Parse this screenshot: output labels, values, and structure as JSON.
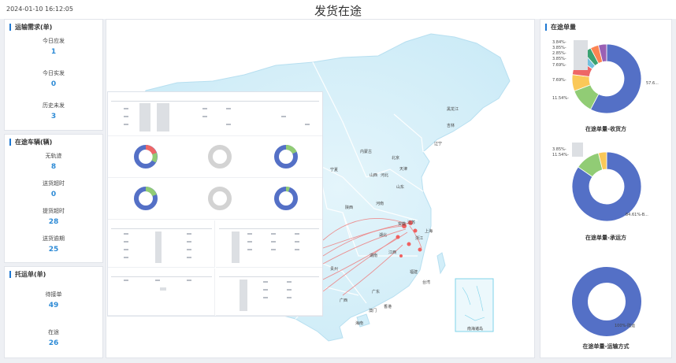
{
  "header": {
    "datetime": "2024-01-10 16:12:05",
    "title": "发货在途"
  },
  "transport_demand": {
    "title": "运输需求(单)",
    "stats": [
      {
        "label": "今日应发",
        "value": "1"
      },
      {
        "label": "今日实发",
        "value": "0"
      },
      {
        "label": "历史未发",
        "value": "3"
      }
    ]
  },
  "vehicles": {
    "title": "在途车辆(辆)",
    "stats": [
      {
        "label": "无轨迹",
        "value": "8"
      },
      {
        "label": "送货超时",
        "value": "0"
      },
      {
        "label": "提货超时",
        "value": "28"
      },
      {
        "label": "送货逾期",
        "value": "25"
      }
    ]
  },
  "consignment": {
    "title": "托运单(单)",
    "stats": [
      {
        "label": "待接单",
        "value": "49"
      },
      {
        "label": "在途",
        "value": "26"
      }
    ]
  },
  "map": {
    "provinces": [
      "黑龙江",
      "吉林",
      "辽宁",
      "内蒙古",
      "北京",
      "天津",
      "山西",
      "河北",
      "山东",
      "宁夏",
      "陕西",
      "河南",
      "安徽",
      "江苏",
      "上海",
      "湖北",
      "浙江",
      "湖南",
      "江西",
      "福建",
      "台湾",
      "广东",
      "广西",
      "贵州",
      "香港",
      "澳门",
      "海南"
    ],
    "inset_label": "南海诸岛",
    "colors": {
      "land": "#d9f1fa",
      "border": "#ffffff",
      "route": "#f07070",
      "sea_inset": "#7fd3ea"
    }
  },
  "right_panel": {
    "title": "在途单量",
    "charts": [
      {
        "caption": "在途单量-收货方",
        "labels": [
          "3.84%-",
          "3.85%-",
          "2.85%-",
          "3.85%-",
          "7.69%-",
          "7.69%-",
          "11.54%-",
          "57.6..."
        ],
        "slices": [
          {
            "pct": 57.69,
            "color": "#5470c6"
          },
          {
            "pct": 11.54,
            "color": "#91cc75"
          },
          {
            "pct": 7.69,
            "color": "#fac858"
          },
          {
            "pct": 7.69,
            "color": "#ee6666"
          },
          {
            "pct": 3.85,
            "color": "#73c0de"
          },
          {
            "pct": 3.85,
            "color": "#3ba272"
          },
          {
            "pct": 3.85,
            "color": "#fc8452"
          },
          {
            "pct": 3.84,
            "color": "#9a60b4"
          }
        ]
      },
      {
        "caption": "在途单量-承运方",
        "labels": [
          "3.85%-",
          "11.54%-",
          "84.61%-B..."
        ],
        "slices": [
          {
            "pct": 84.61,
            "color": "#5470c6"
          },
          {
            "pct": 11.54,
            "color": "#91cc75"
          },
          {
            "pct": 3.85,
            "color": "#fac858"
          }
        ]
      },
      {
        "caption": "在途单量-运输方式",
        "labels": [
          "100%-陆运"
        ],
        "slices": [
          {
            "pct": 100,
            "color": "#5470c6"
          }
        ]
      }
    ]
  }
}
